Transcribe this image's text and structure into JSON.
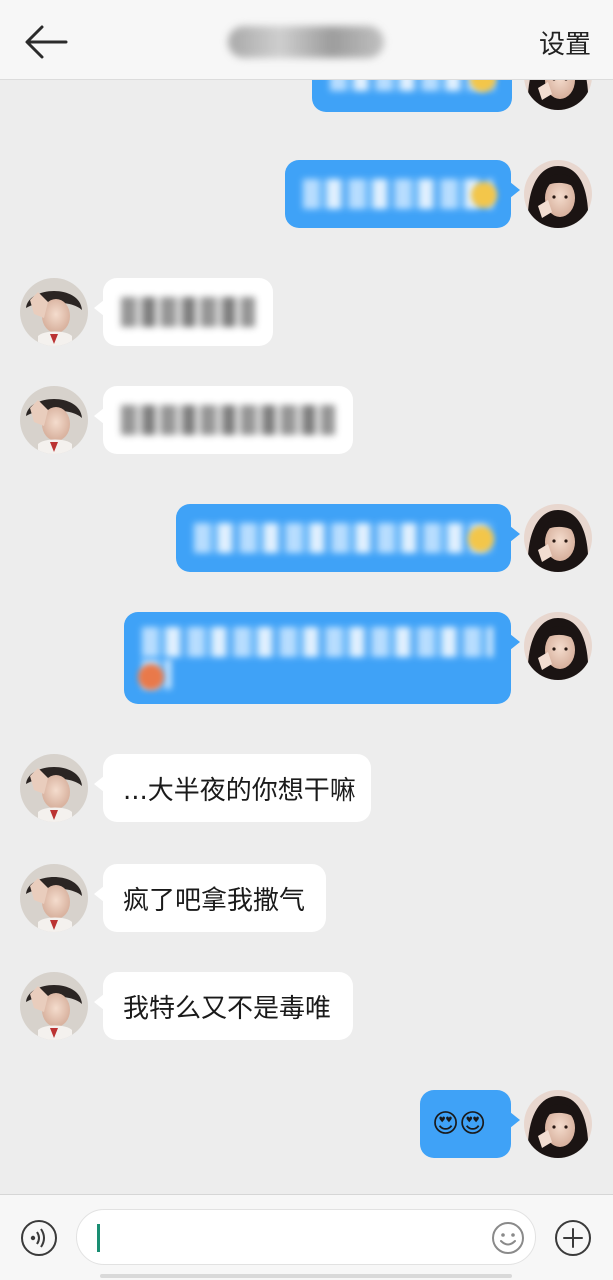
{
  "header": {
    "title_blurred": "",
    "settings_label": "设置",
    "back_icon": "arrow-left-icon"
  },
  "messages": [
    {
      "side": "out",
      "text": "",
      "blurred": true
    },
    {
      "side": "out",
      "text": "",
      "blurred": true
    },
    {
      "side": "in",
      "text": "",
      "blurred": true
    },
    {
      "side": "in",
      "text": "",
      "blurred": true
    },
    {
      "side": "out",
      "text": "",
      "blurred": true
    },
    {
      "side": "out",
      "text": "",
      "blurred": true
    },
    {
      "side": "in",
      "text": "...大半夜的你想干嘛",
      "blurred": false
    },
    {
      "side": "in",
      "text": "疯了吧拿我撒气",
      "blurred": false
    },
    {
      "side": "in",
      "text": "我特么又不是毒唯",
      "blurred": false
    },
    {
      "side": "out",
      "text": "😍😍",
      "blurred": false
    }
  ],
  "composer": {
    "input_value": "",
    "voice_icon": "voice-icon",
    "emoji_icon": "smiley-icon",
    "plus_icon": "plus-icon"
  },
  "colors": {
    "outgoing_bubble": "#3fa2f7",
    "incoming_bubble": "#ffffff",
    "background": "#ededed",
    "caret": "#1a8e73"
  }
}
